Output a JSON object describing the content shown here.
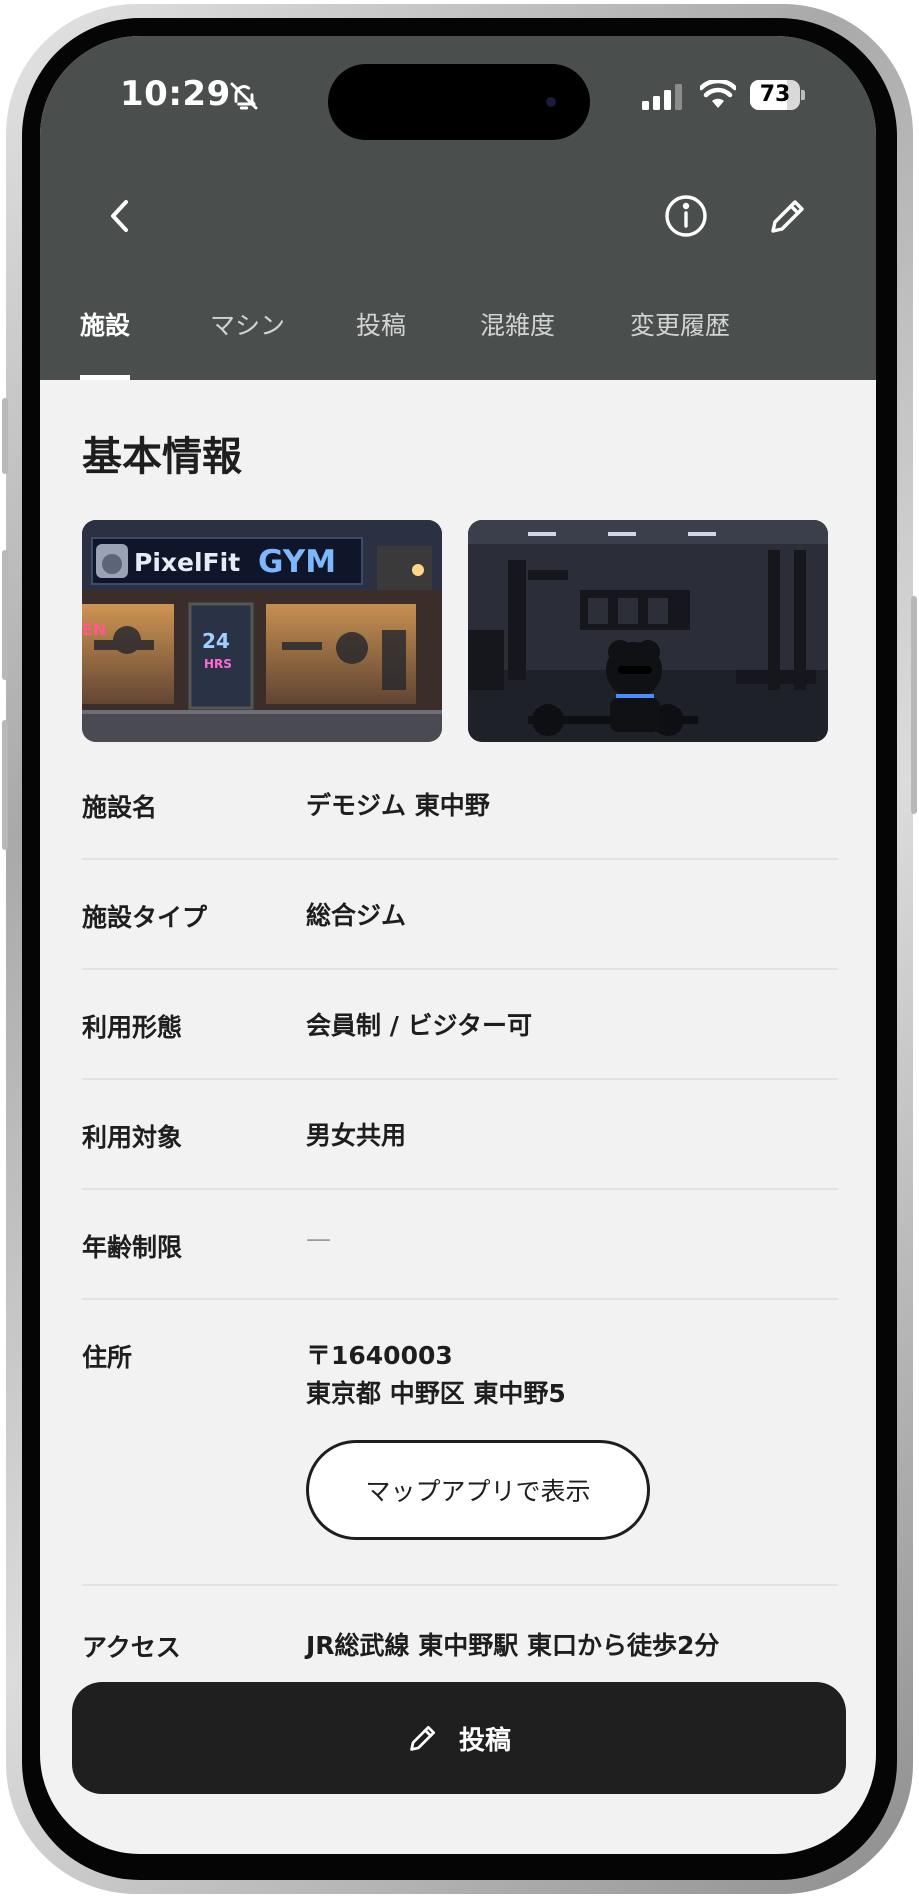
{
  "status_bar": {
    "time": "10:29",
    "battery": "73",
    "battery_level": 0.73,
    "icons": [
      "bell-slash-icon",
      "cellular-signal-icon",
      "wifi-icon",
      "battery-icon"
    ]
  },
  "header": {
    "icons": [
      "back-chevron-icon",
      "info-icon",
      "pencil-icon"
    ],
    "tabs": [
      {
        "label": "施設",
        "active": true
      },
      {
        "label": "マシン",
        "active": false
      },
      {
        "label": "投稿",
        "active": false
      },
      {
        "label": "混雑度",
        "active": false
      },
      {
        "label": "変更履歴",
        "active": false
      }
    ]
  },
  "main": {
    "section_title": "基本情報",
    "photos": {
      "storefront": {
        "sign_text": "PixelFit GYM",
        "door_text_1": "24",
        "door_text_2": "HRS",
        "neon_text": "EN"
      },
      "interior": {}
    },
    "rows": {
      "name": {
        "label": "施設名",
        "value": "デモジム 東中野"
      },
      "type": {
        "label": "施設タイプ",
        "value": "総合ジム"
      },
      "usage": {
        "label": "利用形態",
        "value": "会員制 / ビジター可"
      },
      "target": {
        "label": "利用対象",
        "value": "男女共用"
      },
      "age": {
        "label": "年齢制限",
        "value": "—"
      },
      "address": {
        "label": "住所",
        "postal": "〒1640003",
        "line": "東京都 中野区 東中野5",
        "map_button": "マップアプリで表示"
      },
      "access": {
        "label": "アクセス",
        "value": "JR総武線 東中野駅 東口から徒歩2分"
      }
    }
  },
  "footer": {
    "post_button": "投稿"
  },
  "colors": {
    "header_bg": "#4a4e4d",
    "page_bg": "#f2f2f2",
    "button_dark": "#1f1f1f",
    "text": "#1e1e1e"
  }
}
